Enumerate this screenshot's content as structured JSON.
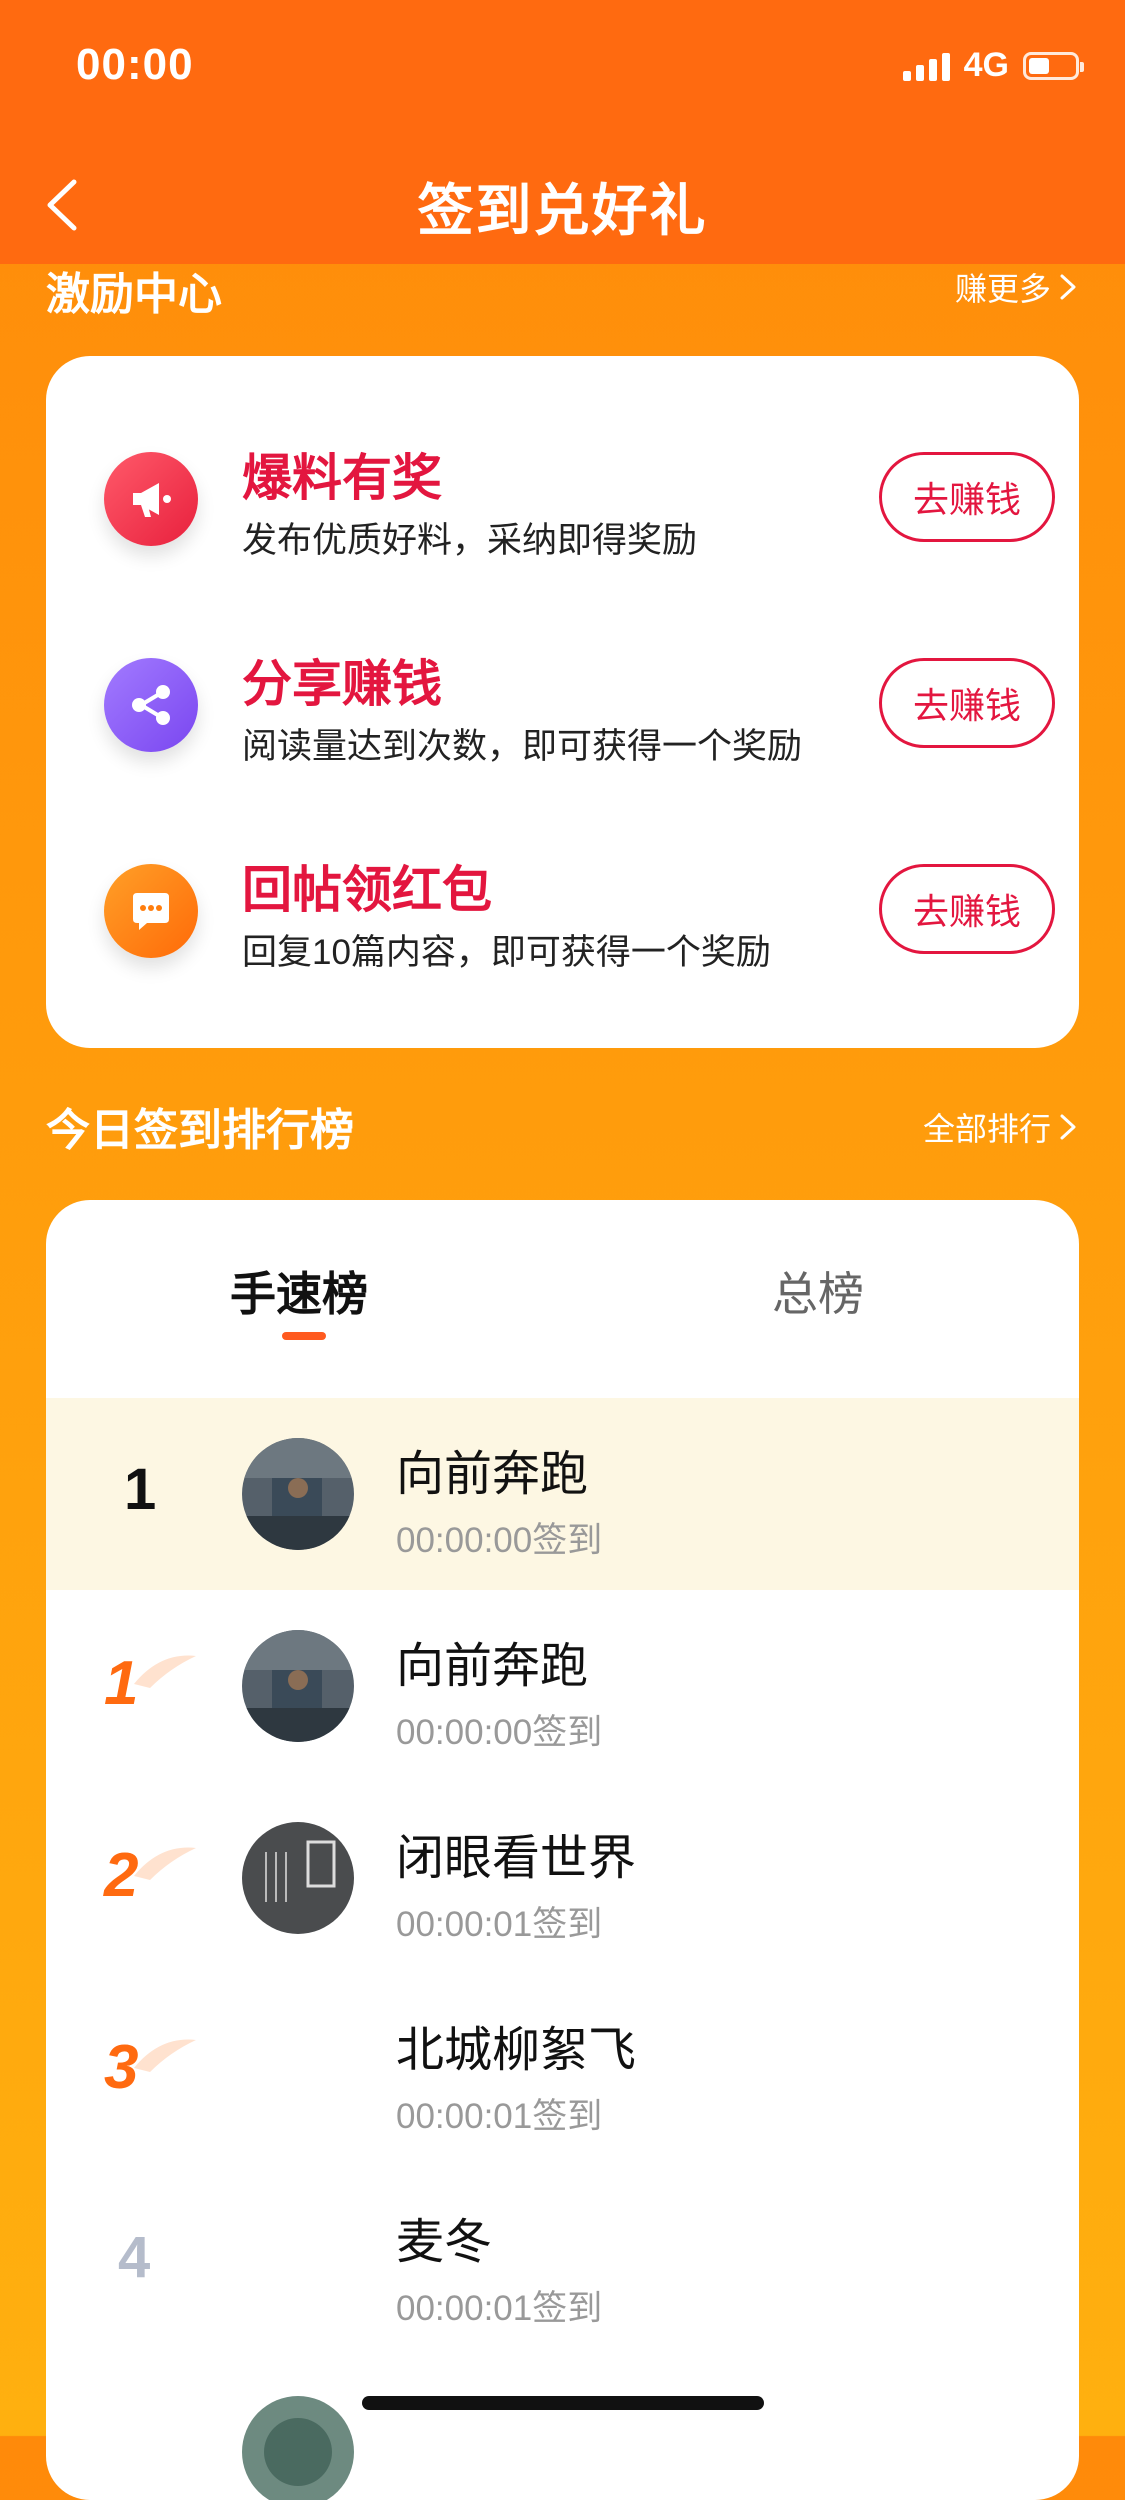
{
  "status_bar": {
    "time": "00:00",
    "network": "4G",
    "battery_level_percent": 40
  },
  "nav": {
    "title": "签到兑好礼",
    "back_icon": "chevron-left-icon"
  },
  "incentive_section": {
    "title": "激励中心",
    "link": "赚更多",
    "tasks": [
      {
        "title": "爆料有奖",
        "desc": "发布优质好料，采纳即得奖励",
        "button": "去赚钱",
        "icon": "megaphone-icon",
        "icon_color": "#f0364f"
      },
      {
        "title": "分享赚钱",
        "desc": "阅读量达到次数，即可获得一个奖励",
        "button": "去赚钱",
        "icon": "share-icon",
        "icon_color": "#8a5cf5"
      },
      {
        "title": "回帖领红包",
        "desc": "回复10篇内容，即可获得一个奖励",
        "button": "去赚钱",
        "icon": "chat-bubble-icon",
        "icon_color": "#ff7d0d"
      }
    ]
  },
  "ranking_section": {
    "title": "今日签到排行榜",
    "link": "全部排行",
    "tabs": [
      {
        "label": "手速榜",
        "active": true
      },
      {
        "label": "总榜",
        "active": false
      }
    ],
    "rows": [
      {
        "rank": "1",
        "name": "向前奔跑",
        "time": "00:00:00签到",
        "highlight": true
      },
      {
        "rank": "1",
        "name": "向前奔跑",
        "time": "00:00:00签到"
      },
      {
        "rank": "2",
        "name": "闭眼看世界",
        "time": "00:00:01签到"
      },
      {
        "rank": "3",
        "name": "北城柳絮飞",
        "time": "00:00:01签到"
      },
      {
        "rank": "4",
        "name": "麦冬",
        "time": "00:00:01签到"
      }
    ]
  },
  "colors": {
    "header_bg": "#ff6a10",
    "accent_red": "#e3163f",
    "highlight_row": "#fdf7e3"
  }
}
